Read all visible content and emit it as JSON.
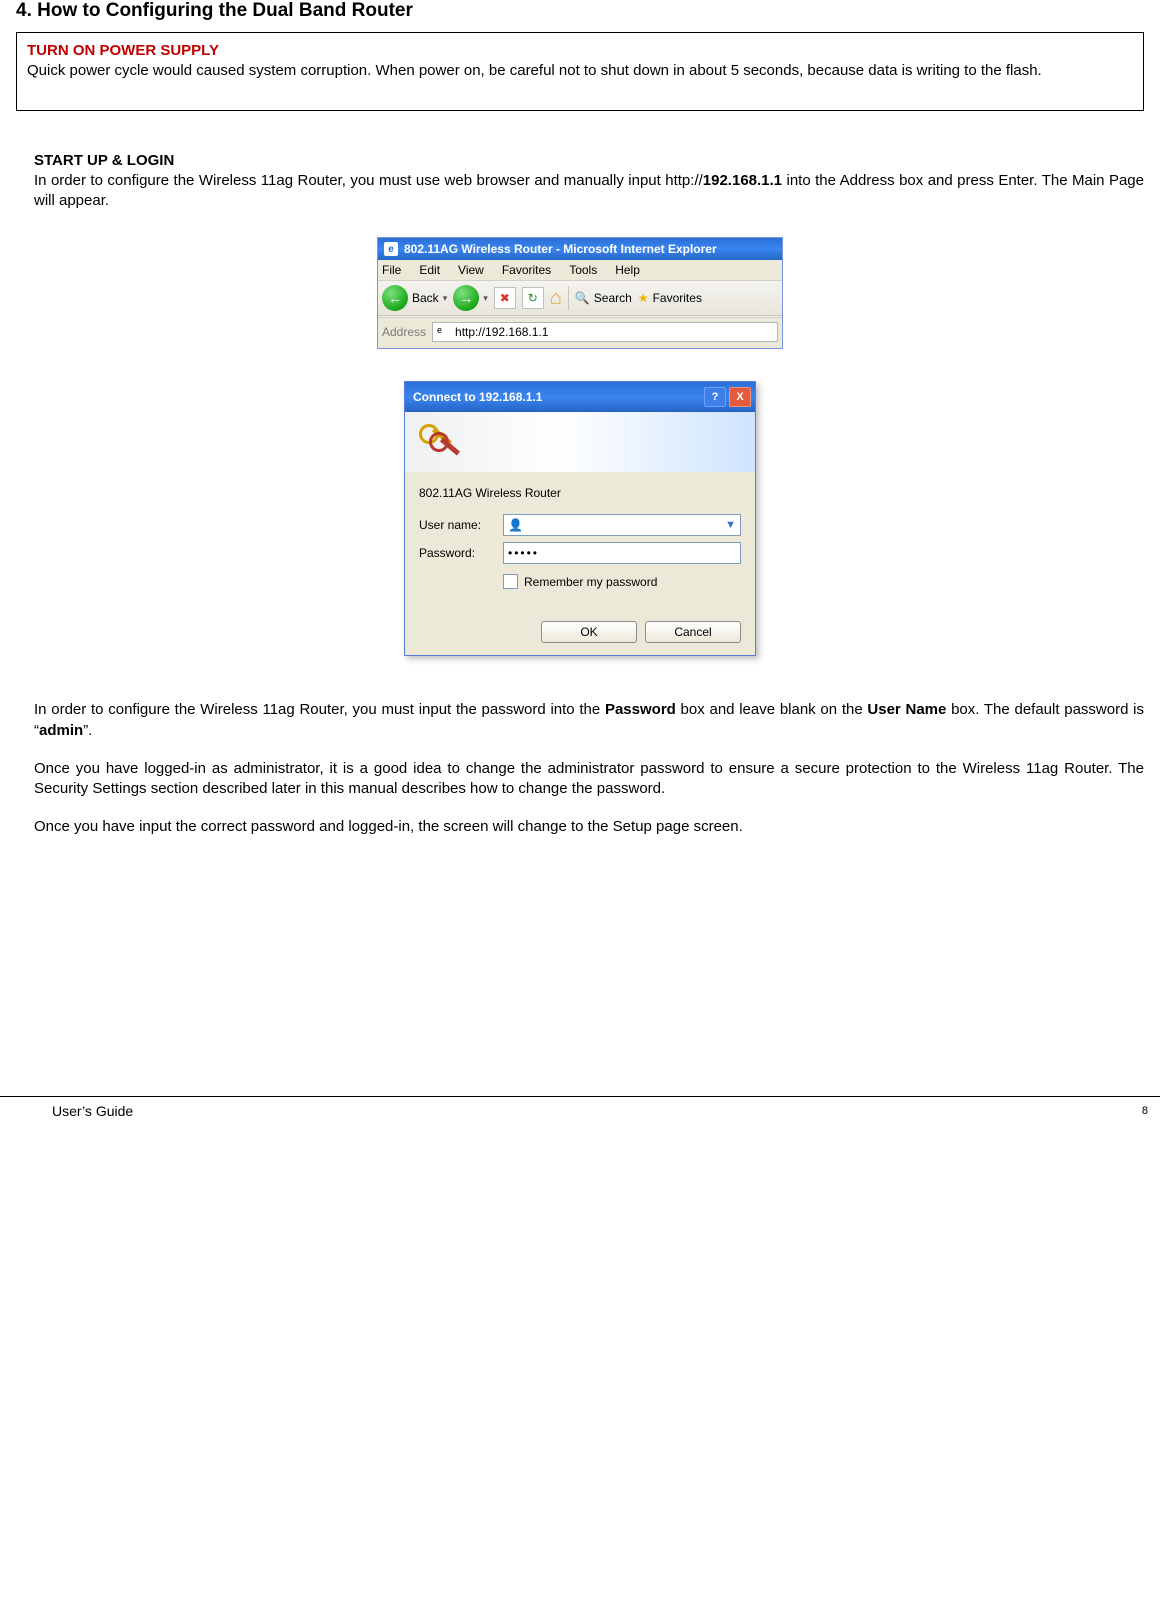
{
  "heading": "4. How to Configuring the Dual Band Router",
  "warning": {
    "title": "TURN ON POWER SUPPLY",
    "text": "Quick power cycle would caused system corruption. When power on, be careful not to shut down in about 5 seconds, because data is writing to the flash."
  },
  "startup": {
    "title": "START UP & LOGIN",
    "line_pre": "In order to configure the Wireless 11ag Router, you must use web browser and manually input http://",
    "ip_bold": "192.168.1.1",
    "line_post": " into the Address box and press Enter. The Main Page will appear."
  },
  "ie_window": {
    "title": "802.11AG Wireless Router - Microsoft Internet Explorer",
    "menu": {
      "file": "File",
      "edit": "Edit",
      "view": "View",
      "favorites": "Favorites",
      "tools": "Tools",
      "help": "Help"
    },
    "toolbar": {
      "back": "Back",
      "search": "Search",
      "favorites": "Favorites"
    },
    "address_label": "Address",
    "address_value": "http://192.168.1.1"
  },
  "auth_dialog": {
    "title": "Connect to 192.168.1.1",
    "realm": "802.11AG Wireless Router",
    "username_label": "User name:",
    "username_value": "",
    "password_label": "Password:",
    "password_value": "•••••",
    "remember_label": "Remember my password",
    "ok": "OK",
    "cancel": "Cancel"
  },
  "para_password": {
    "a": "In order to configure the Wireless 11ag Router, you must input the password into the ",
    "pw": "Password",
    "b": " box and leave blank on the ",
    "un": "User Name",
    "c": " box. The default password is “",
    "admin": "admin",
    "d": "”."
  },
  "para_admin": "Once you have logged-in as administrator, it is a good idea to change the administrator password to ensure a secure protection to the Wireless 11ag Router. The Security Settings section described later in this manual describes how to change the password.",
  "para_setup": "Once you have input the correct password and logged-in, the screen will change to the Setup page screen.",
  "footer": {
    "guide": "User’s Guide",
    "page": "8"
  },
  "glyphs": {
    "back_arrow": "←",
    "fwd_arrow": "→",
    "dropdown": "▾",
    "stop_x": "✖",
    "refresh": "↻",
    "home": "⌂",
    "search": "🔍",
    "star": "★",
    "help_q": "?",
    "close_x": "X",
    "person": "👤",
    "chev_down": "▼",
    "ie_e": "e"
  }
}
